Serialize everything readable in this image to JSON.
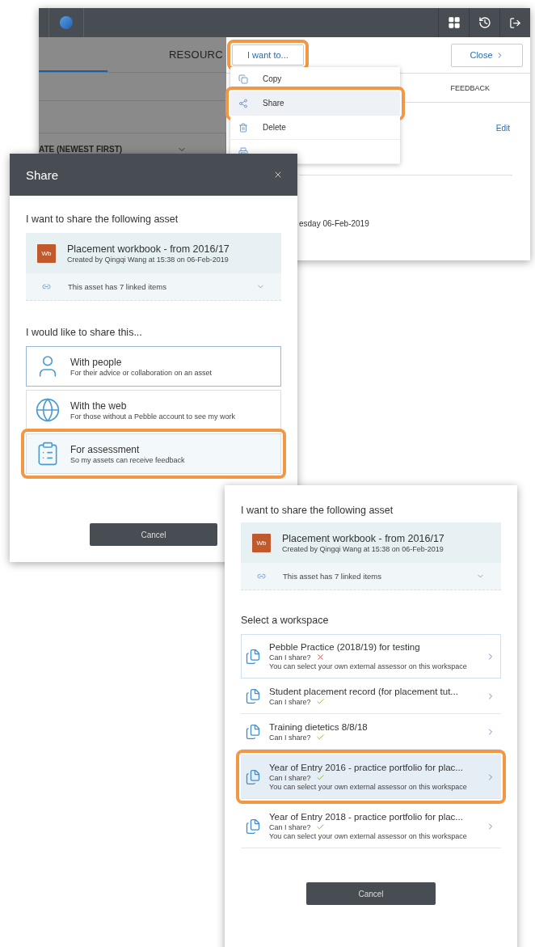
{
  "app_window": {
    "tab_label": "RESOURC",
    "sort_label": "ATE (NEWEST FIRST)",
    "action_button": {
      "label": "I want to...",
      "highlighted": true
    },
    "close_button": "Close",
    "menu": [
      {
        "kind": "copy",
        "label": "Copy",
        "selected": false,
        "highlighted": false
      },
      {
        "kind": "share",
        "label": "Share",
        "selected": true,
        "highlighted": true
      },
      {
        "kind": "delete",
        "label": "Delete",
        "selected": false,
        "highlighted": false
      },
      {
        "kind": "print",
        "selected": false,
        "highlighted": false
      }
    ],
    "feedback_tab": "FEEDBACK",
    "edit_link": "Edit",
    "date_text": "esday 06-Feb-2019"
  },
  "share_dialog": {
    "title": "Share",
    "asset_heading": "I want to share the following asset",
    "asset": {
      "badge": "Wb",
      "title": "Placement workbook - from 2016/17",
      "meta": "Created by Qingqi Wang at 15:38 on 06-Feb-2019",
      "linked": "This asset has 7 linked items"
    },
    "options_heading": "I would like to share this...",
    "options": [
      {
        "kind": "people",
        "title": "With people",
        "description": "For their advice or collaboration on an asset",
        "selected": true,
        "highlighted": false
      },
      {
        "kind": "web",
        "title": "With the web",
        "description": "For those without a Pebble account to see my work",
        "selected": false,
        "highlighted": false
      },
      {
        "kind": "assessment",
        "title": "For assessment",
        "description": "So my assets can receive feedback",
        "selected": false,
        "highlighted": true
      }
    ],
    "cancel": "Cancel"
  },
  "workspace_panel": {
    "asset_heading": "I want to share the following asset",
    "asset": {
      "badge": "Wb",
      "title": "Placement workbook - from 2016/17",
      "meta": "Created by Qingqi Wang at 15:38 on 06-Feb-2019",
      "linked": "This asset has 7 linked items"
    },
    "heading": "Select a workspace",
    "workspaces": [
      {
        "name": "Pebble Practice (2018/19) for testing",
        "can_share_label": "Can I share?",
        "can_share": false,
        "note": "You can select your own external assessor on this workspace",
        "selected": true,
        "highlighted": false
      },
      {
        "name": "Student placement record (for placement tut...",
        "can_share_label": "Can I share?",
        "can_share": true,
        "selected": false,
        "highlighted": false
      },
      {
        "name": "Training dietetics 8/8/18",
        "can_share_label": "Can I share?",
        "can_share": true,
        "selected": false,
        "highlighted": false
      },
      {
        "name": "Year of Entry 2016 - practice portfolio for plac...",
        "can_share_label": "Can I share?",
        "can_share": true,
        "note": "You can select your own external assessor on this workspace",
        "selected": false,
        "highlighted": true
      },
      {
        "name": "Year of Entry 2018 - practice portfolio for plac...",
        "can_share_label": "Can I share?",
        "can_share": true,
        "note": "You can select your own external assessor on this workspace",
        "selected": false,
        "highlighted": false
      }
    ],
    "cancel": "Cancel"
  }
}
